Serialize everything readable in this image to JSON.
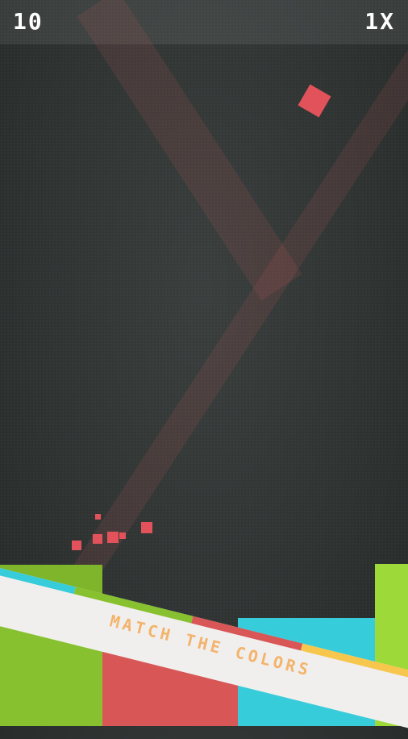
{
  "hud": {
    "score": "10",
    "multiplier": "1X"
  },
  "banner": {
    "text": "MATCH THE COLORS"
  },
  "colors": {
    "background": "#2f3433",
    "red": "#d85656",
    "green": "#88c12f",
    "cyan": "#37ccd9",
    "yellow": "#f7c64d",
    "banner_text": "#f4b36b"
  }
}
